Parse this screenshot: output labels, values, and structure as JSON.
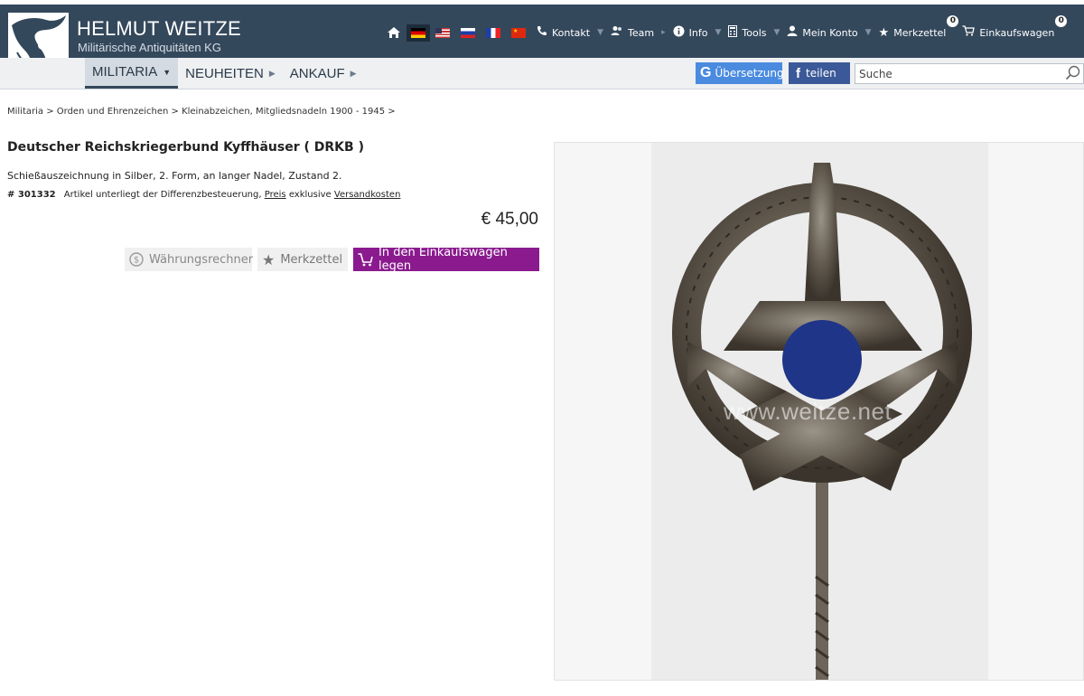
{
  "header": {
    "brand_name": "HELMUT WEITZE",
    "brand_subtitle": "Militärische Antiquitäten KG",
    "nav": [
      {
        "label": "Kontakt",
        "icon": "phone-icon"
      },
      {
        "label": "Team",
        "icon": "team-icon"
      },
      {
        "label": "Info",
        "icon": "info-icon"
      },
      {
        "label": "Tools",
        "icon": "calculator-icon"
      },
      {
        "label": "Mein Konto",
        "icon": "user-icon"
      },
      {
        "label": "Merkzettel",
        "icon": "star-icon",
        "badge": "0"
      },
      {
        "label": "Einkaufswagen",
        "icon": "cart-icon",
        "badge": "0"
      }
    ],
    "flags": [
      "de",
      "us",
      "ru",
      "fr",
      "cn"
    ]
  },
  "mainnav": {
    "items": [
      {
        "label": "MILITARIA",
        "active": true
      },
      {
        "label": "NEUHEITEN"
      },
      {
        "label": "ANKAUF"
      }
    ]
  },
  "tools": {
    "translate_label": "Übersetzung",
    "share_label": "teilen",
    "search_placeholder": "Suche"
  },
  "breadcrumb": "Militaria > Orden und Ehrenzeichen > Kleinabzeichen, Mitgliedsnadeln 1900 - 1945 >",
  "product": {
    "title": "Deutscher Reichskriegerbund Kyffhäuser ( DRKB )",
    "description": "Schießauszeichnung in Silber, 2. Form, an langer Nadel, Zustand 2.",
    "article_number": "# 301332",
    "tax_note": "Artikel unterliegt der Differenzbesteuerung,",
    "price_link": "Preis",
    "exclusive": "exklusive",
    "shipping_link": "Versandkosten",
    "price": "€ 45,00",
    "watermark": "www.weitze.net"
  },
  "buttons": {
    "currency": "Währungsrechner",
    "wishlist": "Merkzettel",
    "cart": "In den Einkaufswagen legen"
  },
  "colors": {
    "header_bg": "#34485c",
    "cart_button": "#8a1a8e",
    "translate_button": "#4a8be0",
    "facebook_button": "#3b5998"
  }
}
